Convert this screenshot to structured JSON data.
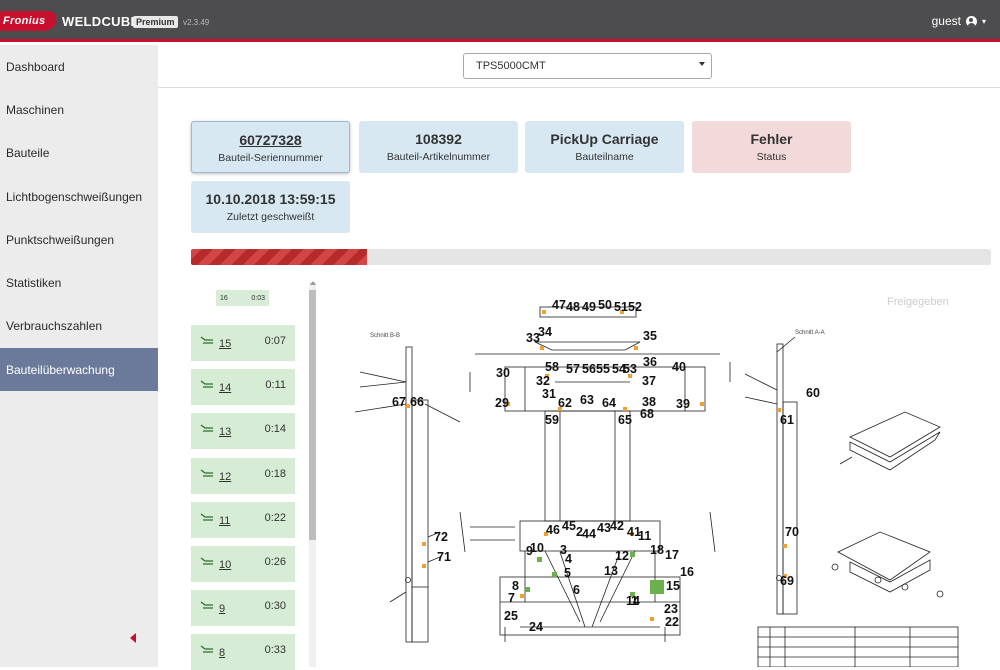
{
  "header": {
    "logo_text": "Fronius",
    "app_name": "WELDCUBE",
    "edition": "Premium",
    "version": "v2.3.49",
    "user": "guest",
    "user_icon": "user-circle-icon",
    "accent_color": "#c8102e",
    "bar_color": "#4d4d4f"
  },
  "sidebar": {
    "items": [
      {
        "label": "Dashboard"
      },
      {
        "label": "Maschinen"
      },
      {
        "label": "Bauteile"
      },
      {
        "label": "Lichtbogenschweißungen"
      },
      {
        "label": "Punktschweißungen"
      },
      {
        "label": "Statistiken"
      },
      {
        "label": "Verbrauchszahlen"
      },
      {
        "label": "Bauteilüberwachung",
        "active": true
      }
    ],
    "active_color": "#6b7a9a"
  },
  "device_select": {
    "value": "TPS5000CMT"
  },
  "cards": [
    {
      "value": "60727328",
      "label": "Bauteil-Seriennummer"
    },
    {
      "value": "108392",
      "label": "Bauteil-Artikelnummer"
    },
    {
      "value": "PickUp Carriage",
      "label": "Bauteilname"
    },
    {
      "value": "Fehler",
      "label": "Status"
    },
    {
      "value": "10.10.2018 13:59:15",
      "label": "Zuletzt geschweißt"
    }
  ],
  "progress": {
    "fraction": 0.22
  },
  "weld_list": {
    "header_num": "16",
    "header_time": "0:03",
    "items": [
      {
        "num": "15",
        "time": "0:07"
      },
      {
        "num": "14",
        "time": "0:11"
      },
      {
        "num": "13",
        "time": "0:14"
      },
      {
        "num": "12",
        "time": "0:18"
      },
      {
        "num": "11",
        "time": "0:22"
      },
      {
        "num": "10",
        "time": "0:26"
      },
      {
        "num": "9",
        "time": "0:30"
      },
      {
        "num": "8",
        "time": "0:33"
      }
    ]
  },
  "drawing": {
    "status_watermark": "Freigegeben",
    "section_left": "Schnitt B-B",
    "section_right": "Schnitt A-A",
    "weld_labels": [
      "1",
      "2",
      "3",
      "4",
      "5",
      "6",
      "7",
      "8",
      "9",
      "10",
      "11",
      "12",
      "13",
      "14",
      "15",
      "16",
      "17",
      "18",
      "22",
      "23",
      "24",
      "25",
      "29",
      "30",
      "31",
      "32",
      "33",
      "34",
      "35",
      "36",
      "37",
      "38",
      "39",
      "40",
      "41",
      "42",
      "43",
      "44",
      "45",
      "46",
      "47",
      "48",
      "49",
      "50",
      "51",
      "52",
      "53",
      "54",
      "55",
      "56",
      "57",
      "58",
      "59",
      "60",
      "61",
      "62",
      "63",
      "64",
      "65",
      "66",
      "67",
      "68",
      "69",
      "70",
      "71",
      "72"
    ]
  }
}
